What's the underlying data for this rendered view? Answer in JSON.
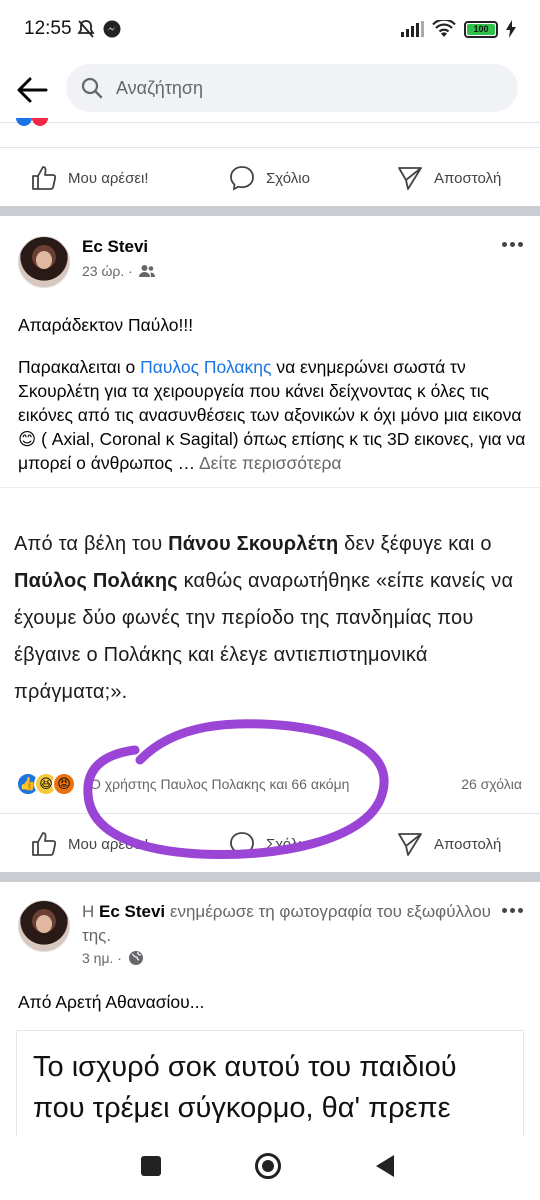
{
  "status_bar": {
    "time": "12:55",
    "battery": "100"
  },
  "header": {
    "search_placeholder": "Αναζήτηση",
    "back_icon": "arrow-left-icon"
  },
  "actions": {
    "like": "Μου αρέσει!",
    "comment": "Σχόλιο",
    "share": "Αποστολή"
  },
  "post1": {
    "author": "Ec Stevi",
    "time": "23 ώρ. ·",
    "audience_icon": "friends-icon",
    "text_line1": "Απαράδεκτον Παύλο!!!",
    "text_p2_before": "Παρακαλειται ο ",
    "text_p2_link": "Παυλος Πολακης",
    "text_p2_after": " να ενημερώνει σωστά τν Σκουρλέτη για τα χειρουργεία που κάνει δείχνοντας κ όλες τις εικόνες από τις  ανασυνθέσεις των αξονικών κ όχι μόνο μια εικονα 😊 ( Axial, Coronal κ Sagital) όπως επίσης κ τις 3D εικονες, για να μπορεί ο άνθρωπος … ",
    "see_more": "Δείτε περισσότερα",
    "shared_text_before": "Από τα βέλη του ",
    "shared_bold1": "Πάνου Σκουρλέτη",
    "shared_mid1": " δεν ξέφυγε και ο ",
    "shared_bold2": "Παύλος Πολάκης",
    "shared_after": " καθώς αναρωτήθηκε «είπε κανείς να έχουμε δύο φωνές την περίοδο της πανδημίας που έβγαινε ο Πολάκης και έλεγε αντιεπιστημονικά πράγματα;».",
    "reactions_text": "Ο χρήστης Παυλος Πολακης και 66 ακόμη",
    "comments_count": "26 σχόλια"
  },
  "post2": {
    "prefix": "Η ",
    "author": "Ec Stevi",
    "action_text": " ενημέρωσε τη φωτογραφία του εξωφύλλου της.",
    "time": "3 ημ. ·",
    "audience_icon": "globe-icon",
    "text": "Από Αρετή Αθανασίου...",
    "image_text": "Το ισχυρό σοκ αυτού του παιδιού που τρέμει σύγκορμο, θα' πρεπε"
  },
  "colors": {
    "link": "#1b74e4",
    "annotation_circle": "#9b45d6"
  }
}
